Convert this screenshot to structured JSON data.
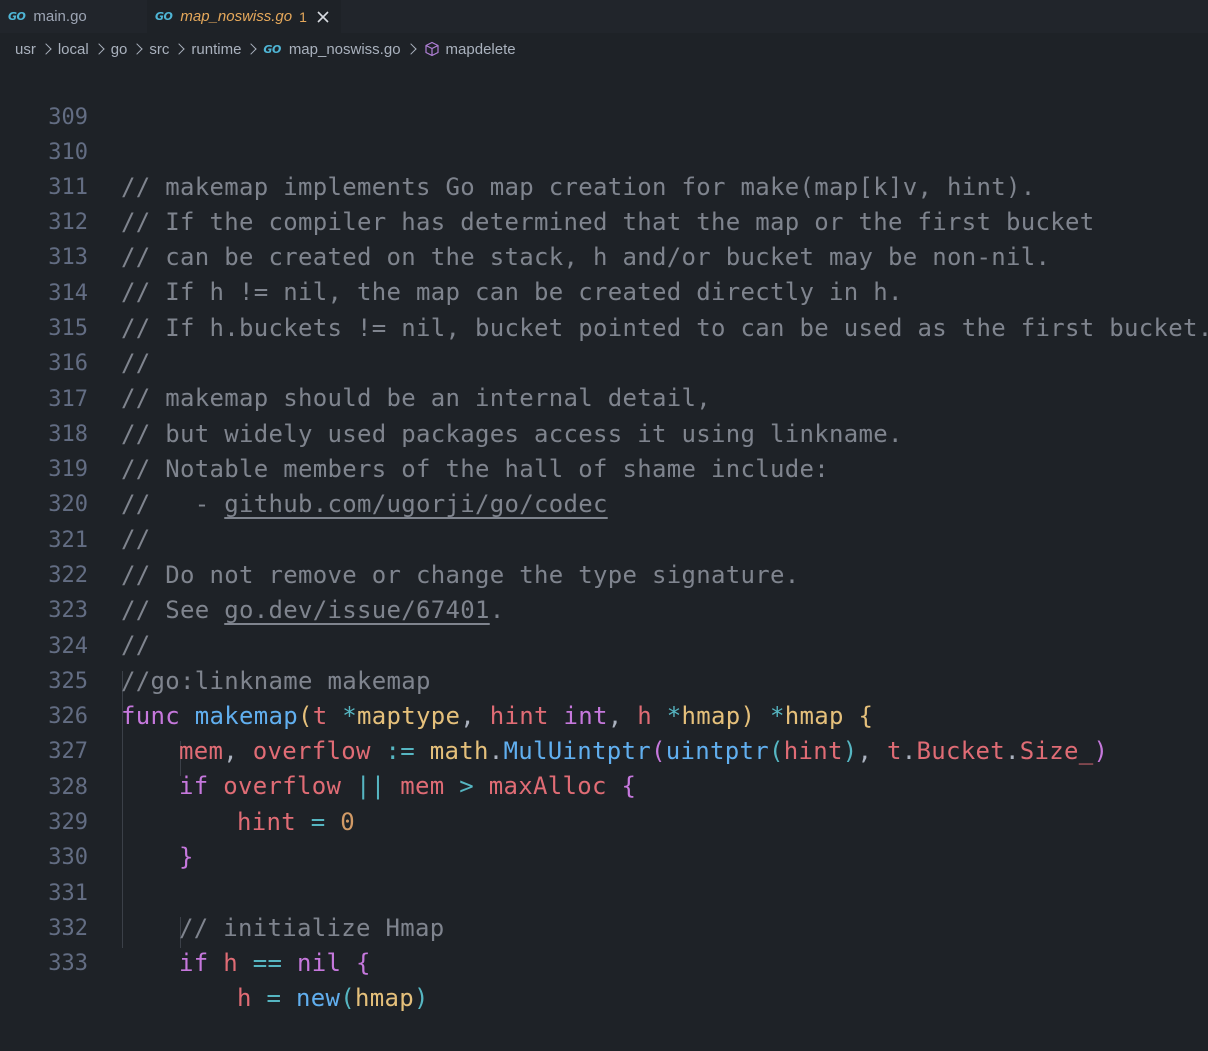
{
  "tabs": [
    {
      "label": "main.go",
      "active": false
    },
    {
      "label": "map_noswiss.go",
      "active": true,
      "badge": "1"
    }
  ],
  "breadcrumb": [
    "usr",
    "local",
    "go",
    "src",
    "runtime",
    "map_noswiss.go",
    "mapdelete"
  ],
  "icons": {
    "go": "go-file-icon",
    "symbol": "cube-method-icon",
    "close": "close-icon",
    "chevron": "chevron-right-icon"
  },
  "colors": {
    "comment": "#7f848e",
    "keyword": "#c678dd",
    "function": "#61afef",
    "variable": "#e06c75",
    "type": "#e5c07b",
    "operator": "#56b6c2",
    "number": "#d19a66"
  },
  "editor": {
    "line_numbers": [
      "309",
      "310",
      "311",
      "312",
      "313",
      "314",
      "315",
      "316",
      "317",
      "318",
      "319",
      "320",
      "321",
      "322",
      "323",
      "324",
      "325",
      "326",
      "327",
      "328",
      "329",
      "330",
      "331",
      "332",
      "333"
    ],
    "lines": {
      "l310": "// makemap implements Go map creation for make(map[k]v, hint).",
      "l311": "// If the compiler has determined that the map or the first bucket",
      "l312": "// can be created on the stack, h and/or bucket may be non-nil.",
      "l313": "// If h != nil, the map can be created directly in h.",
      "l314": "// If h.buckets != nil, bucket pointed to can be used as the first bucket.",
      "l315": "//",
      "l316": "// makemap should be an internal detail,",
      "l317": "// but widely used packages access it using linkname.",
      "l318": "// Notable members of the hall of shame include:",
      "l319_a": "//   - ",
      "l319_b": "github.com/ugorji/go/codec",
      "l320": "//",
      "l321": "// Do not remove or change the type signature.",
      "l322_a": "// See ",
      "l322_b": "go.dev/issue/67401",
      "l322_c": ".",
      "l323": "//",
      "l324": "//go:linkname makemap",
      "l331": "// initialize Hmap"
    }
  }
}
